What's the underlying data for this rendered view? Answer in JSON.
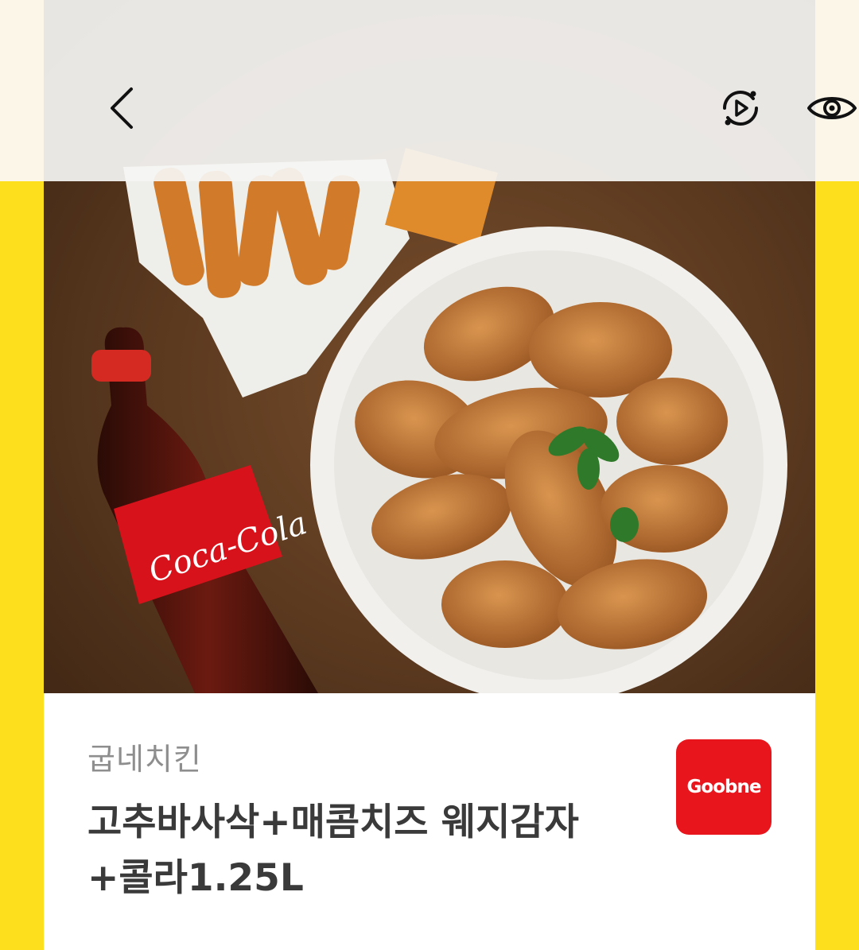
{
  "nav": {
    "back_icon": "chevron-left-icon",
    "replay_icon": "replay-icon",
    "view_icon": "eye-icon"
  },
  "product": {
    "brand": "굽네치킨",
    "title": "고추바사삭+매콤치즈 웨지감자+콜라1.25L",
    "logo_text": "Goobne"
  },
  "image": {
    "cola_label": "Coca-Cola"
  },
  "colors": {
    "frame_yellow": "#fddf1e",
    "logo_red": "#e8151c",
    "table_brown": "#5b3a22"
  }
}
